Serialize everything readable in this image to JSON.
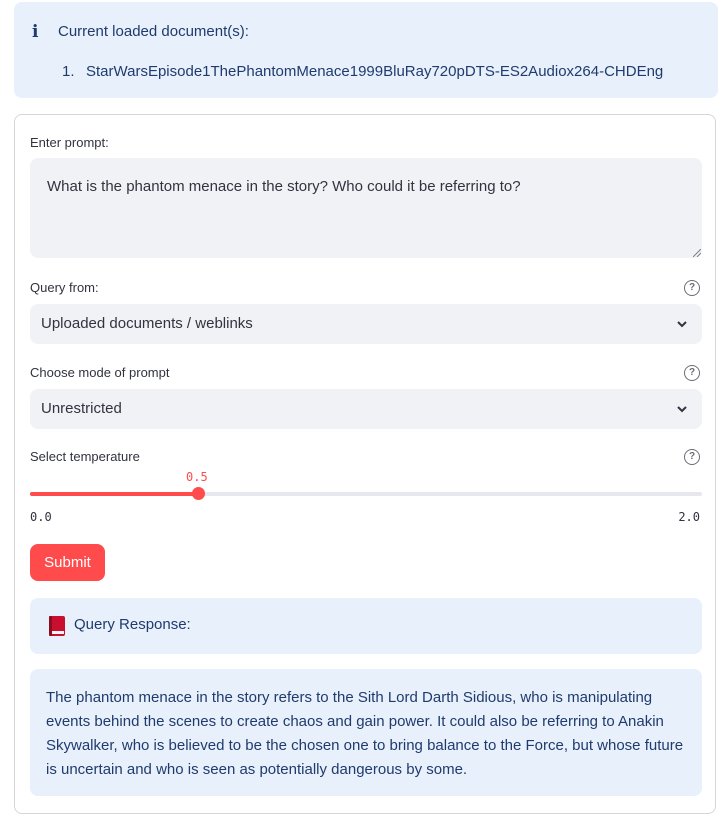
{
  "info": {
    "icon": "info-icon",
    "title": "Current loaded document(s):",
    "documents": [
      {
        "num": "1.",
        "name": "StarWarsEpisode1ThePhantomMenace1999BluRay720pDTS-ES2Audiox264-CHDEng"
      }
    ]
  },
  "prompt": {
    "label": "Enter prompt:",
    "value": "What is the phantom menace in the story? Who could it be referring to?"
  },
  "query_from": {
    "label": "Query from:",
    "selected": "Uploaded documents / weblinks",
    "help": "?"
  },
  "mode": {
    "label": "Choose mode of prompt",
    "selected": "Unrestricted",
    "help": "?"
  },
  "temperature": {
    "label": "Select temperature",
    "value": 0.5,
    "value_text": "0.5",
    "min": "0.0",
    "max": "2.0",
    "help": "?"
  },
  "submit_label": "Submit",
  "response": {
    "title": "Query Response:",
    "icon": "red-book-icon",
    "text": "The phantom menace in the story refers to the Sith Lord Darth Sidious, who is manipulating events behind the scenes to create chaos and gain power. It could also be referring to Anakin Skywalker, who is believed to be the chosen one to bring balance to the Force, but whose future is uncertain and who is seen as potentially dangerous by some."
  },
  "colors": {
    "accent": "#ff4b4b",
    "info_bg": "#e8f0fb",
    "info_text": "#1f3b6e",
    "input_bg": "#f0f2f6"
  }
}
